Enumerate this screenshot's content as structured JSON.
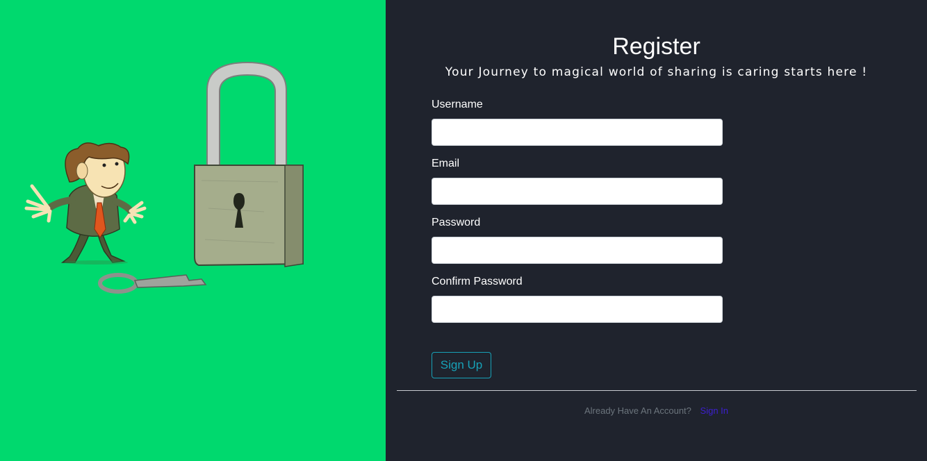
{
  "register": {
    "title": "Register",
    "subtitle": "Your Journey to magical world of sharing is caring starts here !",
    "fields": [
      {
        "label": "Username",
        "value": ""
      },
      {
        "label": "Email",
        "value": ""
      },
      {
        "label": "Password",
        "value": ""
      },
      {
        "label": "Confirm Password",
        "value": ""
      }
    ],
    "submit_label": "Sign Up"
  },
  "footer": {
    "text": "Already Have An Account?",
    "link_label": "Sign In"
  },
  "colors": {
    "left_background": "#00d96e",
    "right_background": "#1f232d",
    "button_accent": "#17a2b8",
    "link": "#3d1fd1"
  },
  "illustration": {
    "icons": [
      "character-icon",
      "padlock-icon",
      "key-icon"
    ]
  }
}
